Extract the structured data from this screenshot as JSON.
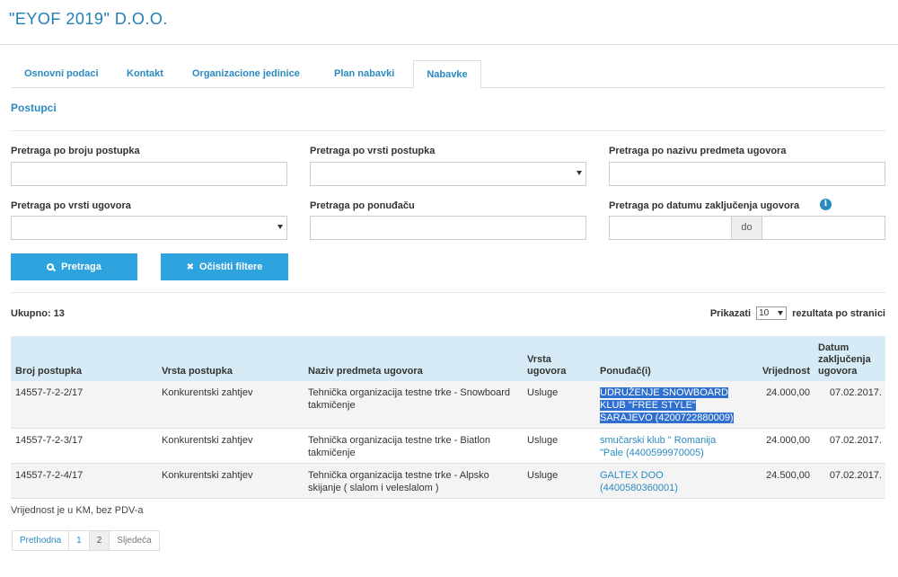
{
  "company": {
    "title": "\"EYOF 2019\" D.O.O."
  },
  "tabs": [
    {
      "label": "Osnovni podaci",
      "active": false
    },
    {
      "label": "Kontakt",
      "active": false
    },
    {
      "label": "Organizacione jedinice",
      "active": false
    },
    {
      "label": "Plan nabavki",
      "active": false
    },
    {
      "label": "Nabavke",
      "active": true
    }
  ],
  "section_title": "Postupci",
  "filters": {
    "procedure_number": {
      "label": "Pretraga po broju postupka",
      "value": ""
    },
    "procedure_type": {
      "label": "Pretraga po vrsti postupka",
      "value": ""
    },
    "contract_subject": {
      "label": "Pretraga po nazivu predmeta ugovora",
      "value": ""
    },
    "contract_type": {
      "label": "Pretraga po vrsti ugovora",
      "value": ""
    },
    "bidder": {
      "label": "Pretraga po ponuđaču",
      "value": ""
    },
    "contract_date": {
      "label": "Pretraga po datumu zaključenja ugovora",
      "from": "",
      "to_label": "do",
      "to": ""
    }
  },
  "buttons": {
    "search": "Pretraga",
    "clear": "Očistiti filtere"
  },
  "icons": {
    "search": "search-icon",
    "clear": "times-icon",
    "info": "info-icon",
    "accent": "#2fa3de"
  },
  "results": {
    "total": "Ukupno: 13",
    "show_label": "Prikazati",
    "per_page": "10",
    "per_page_suffix": "rezultata po stranici"
  },
  "table": {
    "headers": {
      "number": "Broj postupka",
      "proc_type": "Vrsta postupka",
      "subject": "Naziv predmeta ugovora",
      "contract_type": "Vrsta ugovora",
      "bidder": "Ponuđač(i)",
      "value": "Vrijednost",
      "date": "Datum zaključenja ugovora"
    },
    "rows": [
      {
        "number": "14557-7-2-2/17",
        "proc_type": "Konkurentski zahtjev",
        "subject": "Tehnička organizacija testne trke - Snowboard takmičenje",
        "contract_type": "Usluge",
        "bidder": "UDRUŽENJE SNOWBOARD KLUB \"FREE STYLE\" SARAJEVO (4200722880009)",
        "value": "24.000,00",
        "date": "07.02.2017."
      },
      {
        "number": "14557-7-2-3/17",
        "proc_type": "Konkurentski zahtjev",
        "subject": "Tehnička organizacija testne trke - Biatlon takmičenje",
        "contract_type": "Usluge",
        "bidder": "smučarski klub \" Romanija \"Pale (4400599970005)",
        "value": "24.000,00",
        "date": "07.02.2017."
      },
      {
        "number": "14557-7-2-4/17",
        "proc_type": "Konkurentski zahtjev",
        "subject": "Tehnička organizacija testne trke - Alpsko skijanje ( slalom i veleslalom )",
        "contract_type": "Usluge",
        "bidder": "GALTEX DOO (4400580360001)",
        "value": "24.500,00",
        "date": "07.02.2017."
      }
    ]
  },
  "note": "Vrijednost je u KM, bez PDV-a",
  "pagination": {
    "prev": "Prethodna",
    "page1": "1",
    "page2": "2",
    "next": "Sljedeća"
  }
}
